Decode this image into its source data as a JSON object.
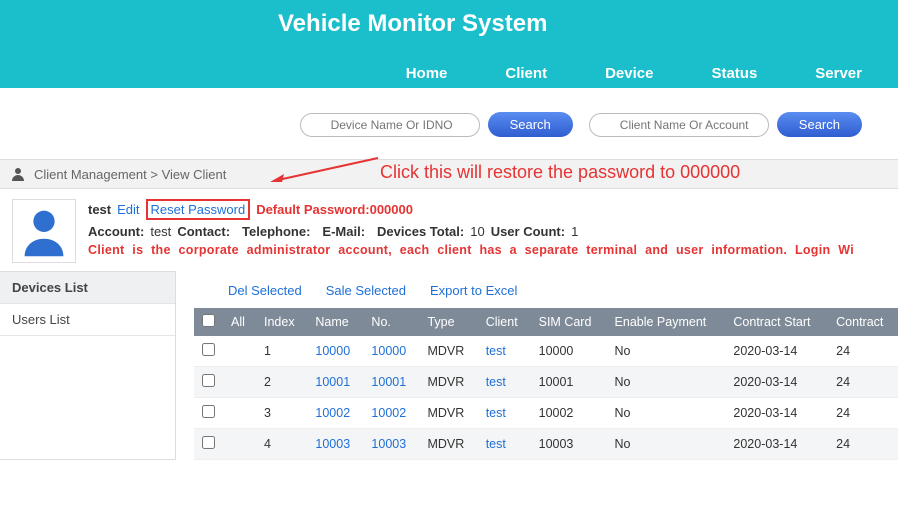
{
  "header": {
    "title": "Vehicle Monitor System",
    "nav": [
      "Home",
      "Client",
      "Device",
      "Status",
      "Server"
    ]
  },
  "search": {
    "device_placeholder": "Device Name Or IDNO",
    "client_placeholder": "Client Name Or Account",
    "btn": "Search"
  },
  "breadcrumb": {
    "a": "Client Management",
    "sep": ">",
    "b": "View Client"
  },
  "annotation": "Click this will restore the password to 000000",
  "client": {
    "name": "test",
    "edit": "Edit",
    "reset": "Reset Password",
    "default_pwd": "Default Password:000000",
    "account_lbl": "Account:",
    "account": "test",
    "contact_lbl": "Contact:",
    "tel_lbl": "Telephone:",
    "email_lbl": "E-Mail:",
    "devtotal_lbl": "Devices Total:",
    "devtotal": "10",
    "usercount_lbl": "User Count:",
    "usercount": "1",
    "note": "Client is the corporate administrator account, each client has a separate terminal and user information. Login Wi"
  },
  "sidebar": {
    "items": [
      "Devices List",
      "Users List"
    ]
  },
  "actions": {
    "del": "Del Selected",
    "sale": "Sale Selected",
    "export": "Export to Excel"
  },
  "table": {
    "headers": [
      "All",
      "Index",
      "Name",
      "No.",
      "Type",
      "Client",
      "SIM Card",
      "Enable Payment",
      "Contract Start",
      "Contract"
    ],
    "rows": [
      {
        "index": "1",
        "name": "10000",
        "no": "10000",
        "type": "MDVR",
        "client": "test",
        "sim": "10000",
        "enable": "No",
        "start": "2020-03-14",
        "end": "24"
      },
      {
        "index": "2",
        "name": "10001",
        "no": "10001",
        "type": "MDVR",
        "client": "test",
        "sim": "10001",
        "enable": "No",
        "start": "2020-03-14",
        "end": "24"
      },
      {
        "index": "3",
        "name": "10002",
        "no": "10002",
        "type": "MDVR",
        "client": "test",
        "sim": "10002",
        "enable": "No",
        "start": "2020-03-14",
        "end": "24"
      },
      {
        "index": "4",
        "name": "10003",
        "no": "10003",
        "type": "MDVR",
        "client": "test",
        "sim": "10003",
        "enable": "No",
        "start": "2020-03-14",
        "end": "24"
      }
    ]
  }
}
